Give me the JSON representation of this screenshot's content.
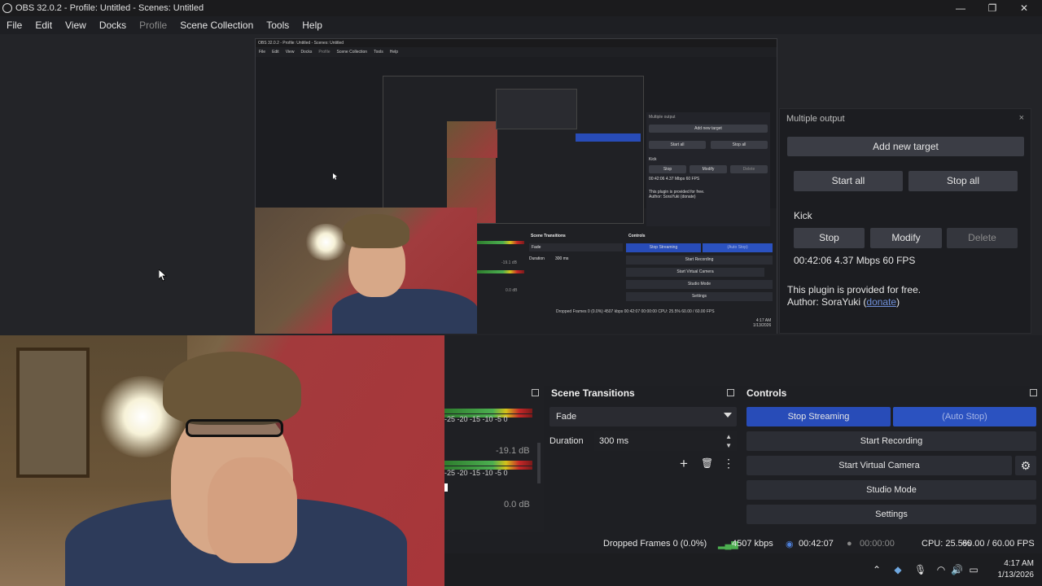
{
  "window": {
    "title": "OBS 32.0.2 - Profile: Untitled - Scenes: Untitled",
    "minimize": "—",
    "restore": "❐",
    "close": "✕"
  },
  "menu": [
    "File",
    "Edit",
    "View",
    "Docks",
    "Profile",
    "Scene Collection",
    "Tools",
    "Help"
  ],
  "mini": {
    "title": "OBS 32.0.2 - Profile: Untitled - Scenes: Untitled",
    "menu": [
      "File",
      "Edit",
      "View",
      "Docks",
      "Profile",
      "Scene Collection",
      "Tools",
      "Help"
    ],
    "multi_title": "Multiple output",
    "add_target": "Add new target",
    "start_all": "Start all",
    "stop_all": "Stop all",
    "kick": "Kick",
    "stop": "Stop",
    "modify": "Modify",
    "delete": "Delete",
    "stats": "00:42:06  4.37 Mbps  60 FPS",
    "free": "This plugin is provided for free.",
    "author": "Author: SoraYuki (donate)",
    "scene_transitions": "Scene Transitions",
    "controls": "Controls",
    "fade": "Fade",
    "duration": "Duration",
    "duration_val": "300 ms",
    "stop_streaming": "Stop Streaming",
    "auto_stop": "(Auto Stop)",
    "start_recording": "Start Recording",
    "start_virtual_camera": "Start Virtual Camera",
    "studio_mode": "Studio Mode",
    "settings": "Settings",
    "db1": "-19.1 dB",
    "db2": "0.0 dB",
    "status": "Dropped Frames 0 (0.0%)   4507 kbps   00:42:07   00:00:00   CPU: 25.5%   60.00 / 60.00 FPS",
    "time": "4:17 AM",
    "date": "1/13/2026"
  },
  "multiple_output": {
    "title": "Multiple output",
    "close": "×",
    "add_new_target": "Add new target",
    "start_all": "Start all",
    "stop_all": "Stop all",
    "target_name": "Kick",
    "stop": "Stop",
    "modify": "Modify",
    "delete": "Delete",
    "stats": "00:42:06  4.37 Mbps  60 FPS",
    "free_text": "This plugin is provided for free.",
    "author_prefix": "Author: SoraYuki (",
    "donate": "donate",
    "author_suffix": ")"
  },
  "audio": {
    "ticks": "-25  -20  -15  -10   -5    0",
    "db_top": "-19.1 dB",
    "db_bottom": "0.0 dB"
  },
  "scene_transitions": {
    "title": "Scene Transitions",
    "transition": "Fade",
    "duration_label": "Duration",
    "duration_value": "300 ms",
    "add": "+",
    "delete": "🗑",
    "more": "⋮"
  },
  "controls": {
    "title": "Controls",
    "stop_streaming": "Stop Streaming",
    "auto_stop": "(Auto Stop)",
    "start_recording": "Start Recording",
    "start_virtual_camera": "Start Virtual Camera",
    "studio_mode": "Studio Mode",
    "settings": "Settings",
    "gear": "⚙"
  },
  "status": {
    "dropped_frames": "Dropped Frames 0 (0.0%)",
    "bitrate": "4507 kbps",
    "stream_time": "00:42:07",
    "record_time": "00:00:00",
    "cpu": "CPU: 25.5%",
    "fps": "60.00 / 60.00 FPS"
  },
  "taskbar": {
    "time": "4:17 AM",
    "date": "1/13/2026"
  },
  "colors": {
    "accent_blue": "#284cb8",
    "link": "#6f8fd8"
  }
}
